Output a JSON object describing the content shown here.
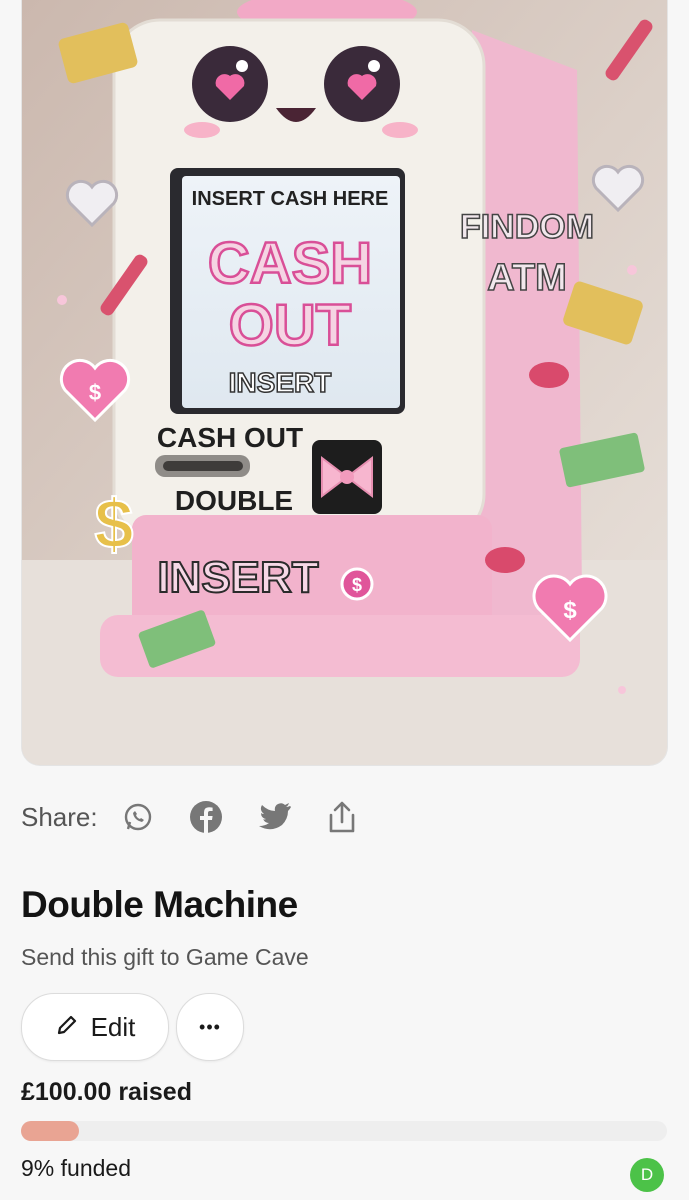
{
  "hero": {
    "screen_line1": "INSERT CASH HERE",
    "screen_cash": "CASH",
    "screen_out": "OUT",
    "screen_insert": "INSERT",
    "panel_cashout": "CASH OUT",
    "panel_double": "DOUBLE",
    "bottom_insert": "INSERT",
    "side_line1": "FINDOM",
    "side_line2": "ATM",
    "colors": {
      "pink": "#f4b6cf",
      "hot_pink": "#e0559a",
      "cream": "#f3f0ea"
    }
  },
  "share": {
    "label": "Share:",
    "icons": [
      "whatsapp-icon",
      "facebook-icon",
      "twitter-icon",
      "share-upload-icon"
    ]
  },
  "gift": {
    "title": "Double Machine",
    "subtitle": "Send this gift to Game Cave"
  },
  "actions": {
    "edit_label": "Edit",
    "more_label": "•••"
  },
  "funding": {
    "raised": "£100.00 raised",
    "progress": 0.09,
    "funded": "9% funded",
    "avatar_initial": "D",
    "accent": "#e9a493",
    "avatar_color": "#4cc248"
  }
}
